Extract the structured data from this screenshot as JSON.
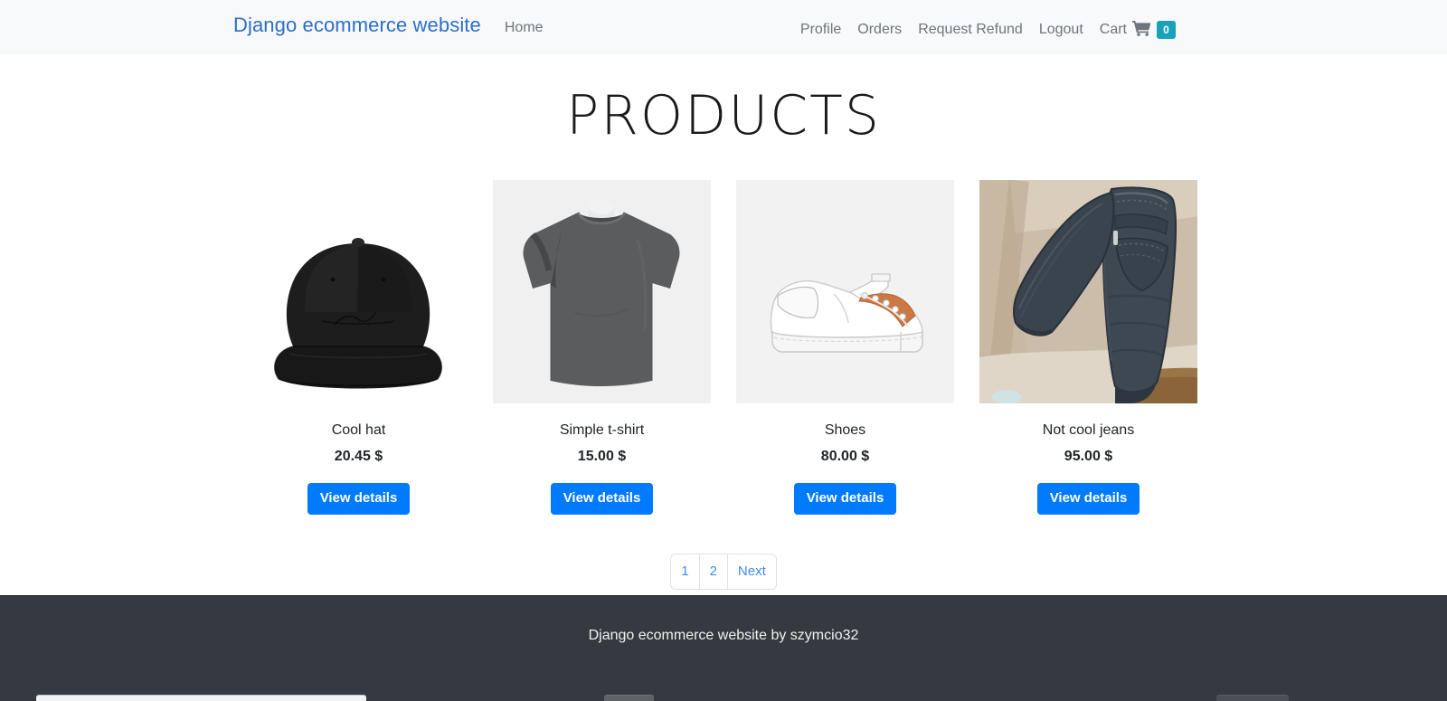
{
  "navbar": {
    "brand": "Django ecommerce website",
    "left_links": [
      {
        "label": "Home",
        "name": "nav-link-home"
      }
    ],
    "right_links": [
      {
        "label": "Profile",
        "name": "nav-link-profile"
      },
      {
        "label": "Orders",
        "name": "nav-link-orders"
      },
      {
        "label": "Request Refund",
        "name": "nav-link-request-refund"
      },
      {
        "label": "Logout",
        "name": "nav-link-logout"
      }
    ],
    "cart": {
      "label": "Cart",
      "icon": "shopping-cart-icon",
      "count": "0",
      "badge_color": "#17a2b8"
    },
    "background": "#f8f9fa",
    "brand_color": "#2c6ecb",
    "link_color": "#6c757d"
  },
  "main": {
    "title": "PRODUCTS",
    "products": [
      {
        "name": "Cool hat",
        "price": "20.45 $",
        "button": "View details",
        "image": "black-snapback-cap-photo",
        "image_bg": "#ffffff"
      },
      {
        "name": "Simple t-shirt",
        "price": "15.00 $",
        "button": "View details",
        "image": "grey-tshirt-photo",
        "image_bg": "#f0f0f0"
      },
      {
        "name": "Shoes",
        "price": "80.00 $",
        "button": "View details",
        "image": "white-orange-sneaker-photo",
        "image_bg": "#f2f2f2"
      },
      {
        "name": "Not cool jeans",
        "price": "95.00 $",
        "button": "View details",
        "image": "folded-dark-jeans-photo",
        "image_bg": "#d8cbba"
      }
    ],
    "button_color": "#007bff"
  },
  "pagination": {
    "items": [
      {
        "label": "1",
        "name": "page-link-1"
      },
      {
        "label": "2",
        "name": "page-link-2"
      },
      {
        "label": "Next",
        "name": "page-link-next"
      }
    ],
    "link_color": "#3d8bfd"
  },
  "footer": {
    "text": "Django ecommerce website by szymcio32",
    "background": "#343a40"
  }
}
